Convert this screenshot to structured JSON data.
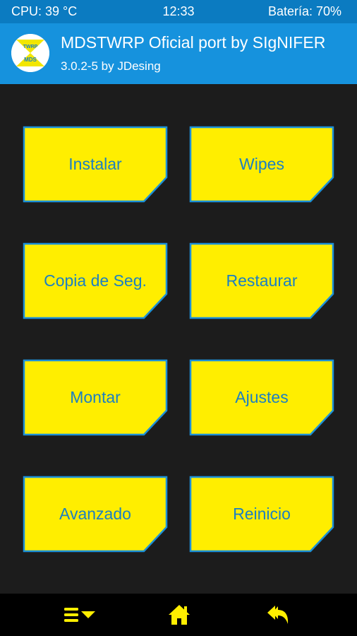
{
  "status_bar": {
    "cpu": "CPU: 39 °C",
    "time": "12:33",
    "battery": "Batería: 70%"
  },
  "header": {
    "title": "MDSTWRP Oficial port by SIgNIFER",
    "subtitle": "3.0.2-5 by JDesing",
    "logo": {
      "top_text": "TWRP",
      "bottom_text": "MDS"
    }
  },
  "menu": {
    "items": [
      {
        "label": "Instalar"
      },
      {
        "label": "Wipes"
      },
      {
        "label": "Copia de Seg."
      },
      {
        "label": "Restaurar"
      },
      {
        "label": "Montar"
      },
      {
        "label": "Ajustes"
      },
      {
        "label": "Avanzado"
      },
      {
        "label": "Reinicio"
      }
    ]
  },
  "nav": {
    "menu_icon": "menu-dropdown-icon",
    "home_icon": "home-icon",
    "back_icon": "back-reply-icon"
  },
  "colors": {
    "status_bar": "#0b7bc1",
    "header": "#1692dd",
    "background": "#1c1c1c",
    "tile_fill": "#ffee00",
    "tile_border": "#1b90d8",
    "tile_text": "#1b7fc4",
    "nav_bar": "#000000",
    "nav_icon": "#ffee00"
  }
}
